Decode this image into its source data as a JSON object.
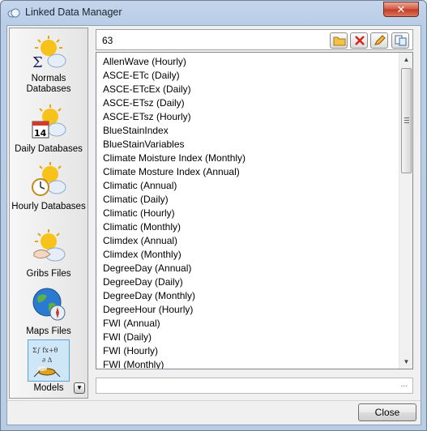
{
  "window": {
    "title": "Linked Data Manager",
    "close_glyph": "✕"
  },
  "nav": {
    "items": [
      {
        "label": "Normals Databases",
        "icon": "normals-database-icon"
      },
      {
        "label": "Daily Databases",
        "icon": "daily-database-icon"
      },
      {
        "label": "Hourly Databases",
        "icon": "hourly-database-icon"
      },
      {
        "label": "Gribs Files",
        "icon": "gribs-file-icon"
      },
      {
        "label": "Maps Files",
        "icon": "maps-file-icon"
      },
      {
        "label": "Models",
        "icon": "models-icon",
        "selected": true
      }
    ],
    "more_glyph": "▼"
  },
  "header": {
    "count": "63"
  },
  "toolbar": [
    "open-folder-icon",
    "delete-icon",
    "edit-icon",
    "copy-icon"
  ],
  "list": {
    "items": [
      "AllenWave (Hourly)",
      "ASCE-ETc (Daily)",
      "ASCE-ETcEx (Daily)",
      "ASCE-ETsz (Daily)",
      "ASCE-ETsz (Hourly)",
      "BlueStainIndex",
      "BlueStainVariables",
      "Climate Moisture Index (Monthly)",
      "Climate Mosture Index (Annual)",
      "Climatic (Annual)",
      "Climatic (Daily)",
      "Climatic (Hourly)",
      "Climatic (Monthly)",
      "Climdex (Annual)",
      "Climdex (Monthly)",
      "DegreeDay (Annual)",
      "DegreeDay (Daily)",
      "DegreeDay (Monthly)",
      "DegreeHour (Hourly)",
      "FWI (Annual)",
      "FWI (Daily)",
      "FWI (Hourly)",
      "FWI (Monthly)"
    ]
  },
  "path": {
    "value": "",
    "ellipsis": "..."
  },
  "footer": {
    "close_label": "Close"
  },
  "colors": {
    "selection": "#cfe6f7",
    "selection_border": "#5aa3dc",
    "close_red": "#c43a23"
  }
}
